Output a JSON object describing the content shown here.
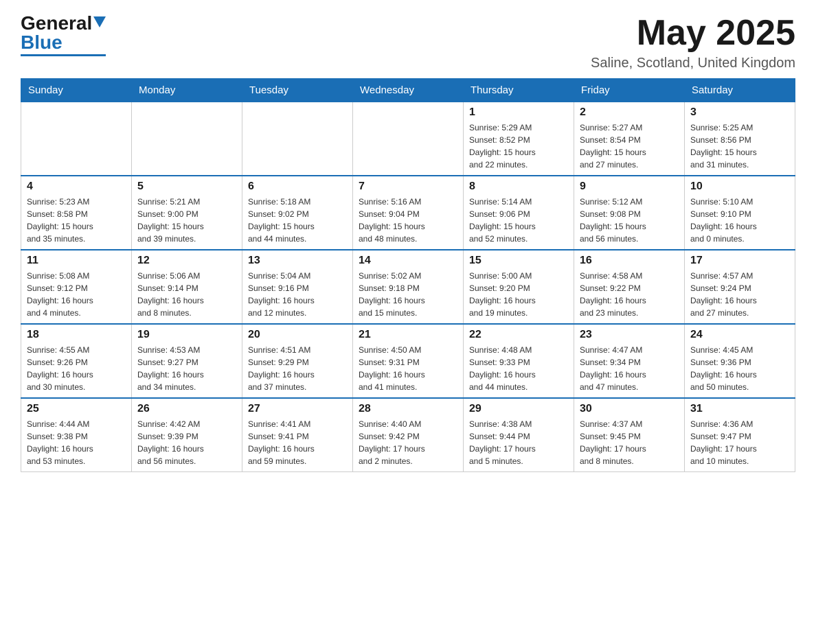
{
  "header": {
    "logo_general": "General",
    "logo_blue": "Blue",
    "month_title": "May 2025",
    "location": "Saline, Scotland, United Kingdom"
  },
  "days_of_week": [
    "Sunday",
    "Monday",
    "Tuesday",
    "Wednesday",
    "Thursday",
    "Friday",
    "Saturday"
  ],
  "weeks": [
    [
      {
        "day": "",
        "info": ""
      },
      {
        "day": "",
        "info": ""
      },
      {
        "day": "",
        "info": ""
      },
      {
        "day": "",
        "info": ""
      },
      {
        "day": "1",
        "info": "Sunrise: 5:29 AM\nSunset: 8:52 PM\nDaylight: 15 hours\nand 22 minutes."
      },
      {
        "day": "2",
        "info": "Sunrise: 5:27 AM\nSunset: 8:54 PM\nDaylight: 15 hours\nand 27 minutes."
      },
      {
        "day": "3",
        "info": "Sunrise: 5:25 AM\nSunset: 8:56 PM\nDaylight: 15 hours\nand 31 minutes."
      }
    ],
    [
      {
        "day": "4",
        "info": "Sunrise: 5:23 AM\nSunset: 8:58 PM\nDaylight: 15 hours\nand 35 minutes."
      },
      {
        "day": "5",
        "info": "Sunrise: 5:21 AM\nSunset: 9:00 PM\nDaylight: 15 hours\nand 39 minutes."
      },
      {
        "day": "6",
        "info": "Sunrise: 5:18 AM\nSunset: 9:02 PM\nDaylight: 15 hours\nand 44 minutes."
      },
      {
        "day": "7",
        "info": "Sunrise: 5:16 AM\nSunset: 9:04 PM\nDaylight: 15 hours\nand 48 minutes."
      },
      {
        "day": "8",
        "info": "Sunrise: 5:14 AM\nSunset: 9:06 PM\nDaylight: 15 hours\nand 52 minutes."
      },
      {
        "day": "9",
        "info": "Sunrise: 5:12 AM\nSunset: 9:08 PM\nDaylight: 15 hours\nand 56 minutes."
      },
      {
        "day": "10",
        "info": "Sunrise: 5:10 AM\nSunset: 9:10 PM\nDaylight: 16 hours\nand 0 minutes."
      }
    ],
    [
      {
        "day": "11",
        "info": "Sunrise: 5:08 AM\nSunset: 9:12 PM\nDaylight: 16 hours\nand 4 minutes."
      },
      {
        "day": "12",
        "info": "Sunrise: 5:06 AM\nSunset: 9:14 PM\nDaylight: 16 hours\nand 8 minutes."
      },
      {
        "day": "13",
        "info": "Sunrise: 5:04 AM\nSunset: 9:16 PM\nDaylight: 16 hours\nand 12 minutes."
      },
      {
        "day": "14",
        "info": "Sunrise: 5:02 AM\nSunset: 9:18 PM\nDaylight: 16 hours\nand 15 minutes."
      },
      {
        "day": "15",
        "info": "Sunrise: 5:00 AM\nSunset: 9:20 PM\nDaylight: 16 hours\nand 19 minutes."
      },
      {
        "day": "16",
        "info": "Sunrise: 4:58 AM\nSunset: 9:22 PM\nDaylight: 16 hours\nand 23 minutes."
      },
      {
        "day": "17",
        "info": "Sunrise: 4:57 AM\nSunset: 9:24 PM\nDaylight: 16 hours\nand 27 minutes."
      }
    ],
    [
      {
        "day": "18",
        "info": "Sunrise: 4:55 AM\nSunset: 9:26 PM\nDaylight: 16 hours\nand 30 minutes."
      },
      {
        "day": "19",
        "info": "Sunrise: 4:53 AM\nSunset: 9:27 PM\nDaylight: 16 hours\nand 34 minutes."
      },
      {
        "day": "20",
        "info": "Sunrise: 4:51 AM\nSunset: 9:29 PM\nDaylight: 16 hours\nand 37 minutes."
      },
      {
        "day": "21",
        "info": "Sunrise: 4:50 AM\nSunset: 9:31 PM\nDaylight: 16 hours\nand 41 minutes."
      },
      {
        "day": "22",
        "info": "Sunrise: 4:48 AM\nSunset: 9:33 PM\nDaylight: 16 hours\nand 44 minutes."
      },
      {
        "day": "23",
        "info": "Sunrise: 4:47 AM\nSunset: 9:34 PM\nDaylight: 16 hours\nand 47 minutes."
      },
      {
        "day": "24",
        "info": "Sunrise: 4:45 AM\nSunset: 9:36 PM\nDaylight: 16 hours\nand 50 minutes."
      }
    ],
    [
      {
        "day": "25",
        "info": "Sunrise: 4:44 AM\nSunset: 9:38 PM\nDaylight: 16 hours\nand 53 minutes."
      },
      {
        "day": "26",
        "info": "Sunrise: 4:42 AM\nSunset: 9:39 PM\nDaylight: 16 hours\nand 56 minutes."
      },
      {
        "day": "27",
        "info": "Sunrise: 4:41 AM\nSunset: 9:41 PM\nDaylight: 16 hours\nand 59 minutes."
      },
      {
        "day": "28",
        "info": "Sunrise: 4:40 AM\nSunset: 9:42 PM\nDaylight: 17 hours\nand 2 minutes."
      },
      {
        "day": "29",
        "info": "Sunrise: 4:38 AM\nSunset: 9:44 PM\nDaylight: 17 hours\nand 5 minutes."
      },
      {
        "day": "30",
        "info": "Sunrise: 4:37 AM\nSunset: 9:45 PM\nDaylight: 17 hours\nand 8 minutes."
      },
      {
        "day": "31",
        "info": "Sunrise: 4:36 AM\nSunset: 9:47 PM\nDaylight: 17 hours\nand 10 minutes."
      }
    ]
  ]
}
